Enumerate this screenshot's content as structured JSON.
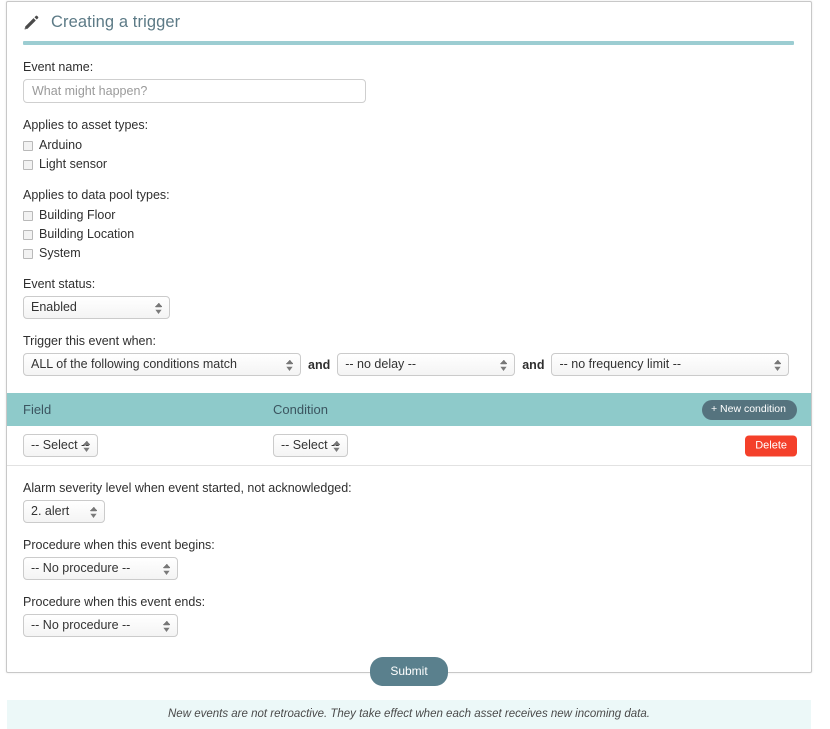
{
  "header": {
    "title": "Creating a trigger",
    "icon": "pencil-icon"
  },
  "form": {
    "event_name": {
      "label": "Event name:",
      "value": "",
      "placeholder": "What might happen?"
    },
    "asset_types": {
      "label": "Applies to asset types:",
      "options": [
        {
          "label": "Arduino",
          "checked": false
        },
        {
          "label": "Light sensor",
          "checked": false
        }
      ]
    },
    "data_pool_types": {
      "label": "Applies to data pool types:",
      "options": [
        {
          "label": "Building Floor",
          "checked": false
        },
        {
          "label": "Building Location",
          "checked": false
        },
        {
          "label": "System",
          "checked": false
        }
      ]
    },
    "event_status": {
      "label": "Event status:",
      "value": "Enabled"
    },
    "trigger_when": {
      "label": "Trigger this event when:",
      "match_value": "ALL of the following conditions match",
      "and_label_1": "and",
      "delay_value": "-- no delay --",
      "and_label_2": "and",
      "frequency_value": "-- no frequency limit --"
    },
    "conditions": {
      "columns": [
        "Field",
        "Condition"
      ],
      "new_condition_label": "+ New condition",
      "rows": [
        {
          "field_value": "-- Select --",
          "condition_value": "-- Select --",
          "delete_label": "Delete"
        }
      ]
    },
    "severity": {
      "label": "Alarm severity level when event started, not acknowledged:",
      "value": "2. alert"
    },
    "procedure_begins": {
      "label": "Procedure when this event begins:",
      "value": "-- No procedure --"
    },
    "procedure_ends": {
      "label": "Procedure when this event ends:",
      "value": "-- No procedure --"
    }
  },
  "footer": {
    "submit_label": "Submit",
    "note": "New events are not retroactive. They take effect when each asset receives new incoming data."
  },
  "colors": {
    "teal_header": "#8ecaca",
    "teal_rule": "#9ccdd2",
    "title_text": "#5c7a86",
    "submit": "#5a808d",
    "delete": "#f4402a",
    "new_condition": "#55737e",
    "footer_band": "#ecf8f8"
  }
}
